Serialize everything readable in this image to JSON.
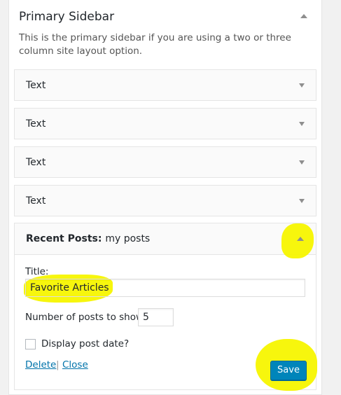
{
  "sidebar": {
    "title": "Primary Sidebar",
    "description": "This is the primary sidebar if you are using a two or three column site layout option.",
    "widgets": [
      {
        "title": "Text"
      },
      {
        "title": "Text"
      },
      {
        "title": "Text"
      },
      {
        "title": "Text"
      }
    ]
  },
  "open_widget": {
    "title": "Recent Posts:",
    "instance_title": "my posts",
    "title_label": "Title:",
    "title_value": "Favorite Articles",
    "number_label": "Number of posts to show:",
    "number_value": "5",
    "show_date_label": "Display post date?",
    "show_date_checked": false,
    "delete_label": "Delete",
    "separator": "|",
    "close_label": "Close",
    "save_label": "Save"
  },
  "colors": {
    "highlight": "#f7f500",
    "primary_button": "#0085ba",
    "link": "#0073aa"
  }
}
